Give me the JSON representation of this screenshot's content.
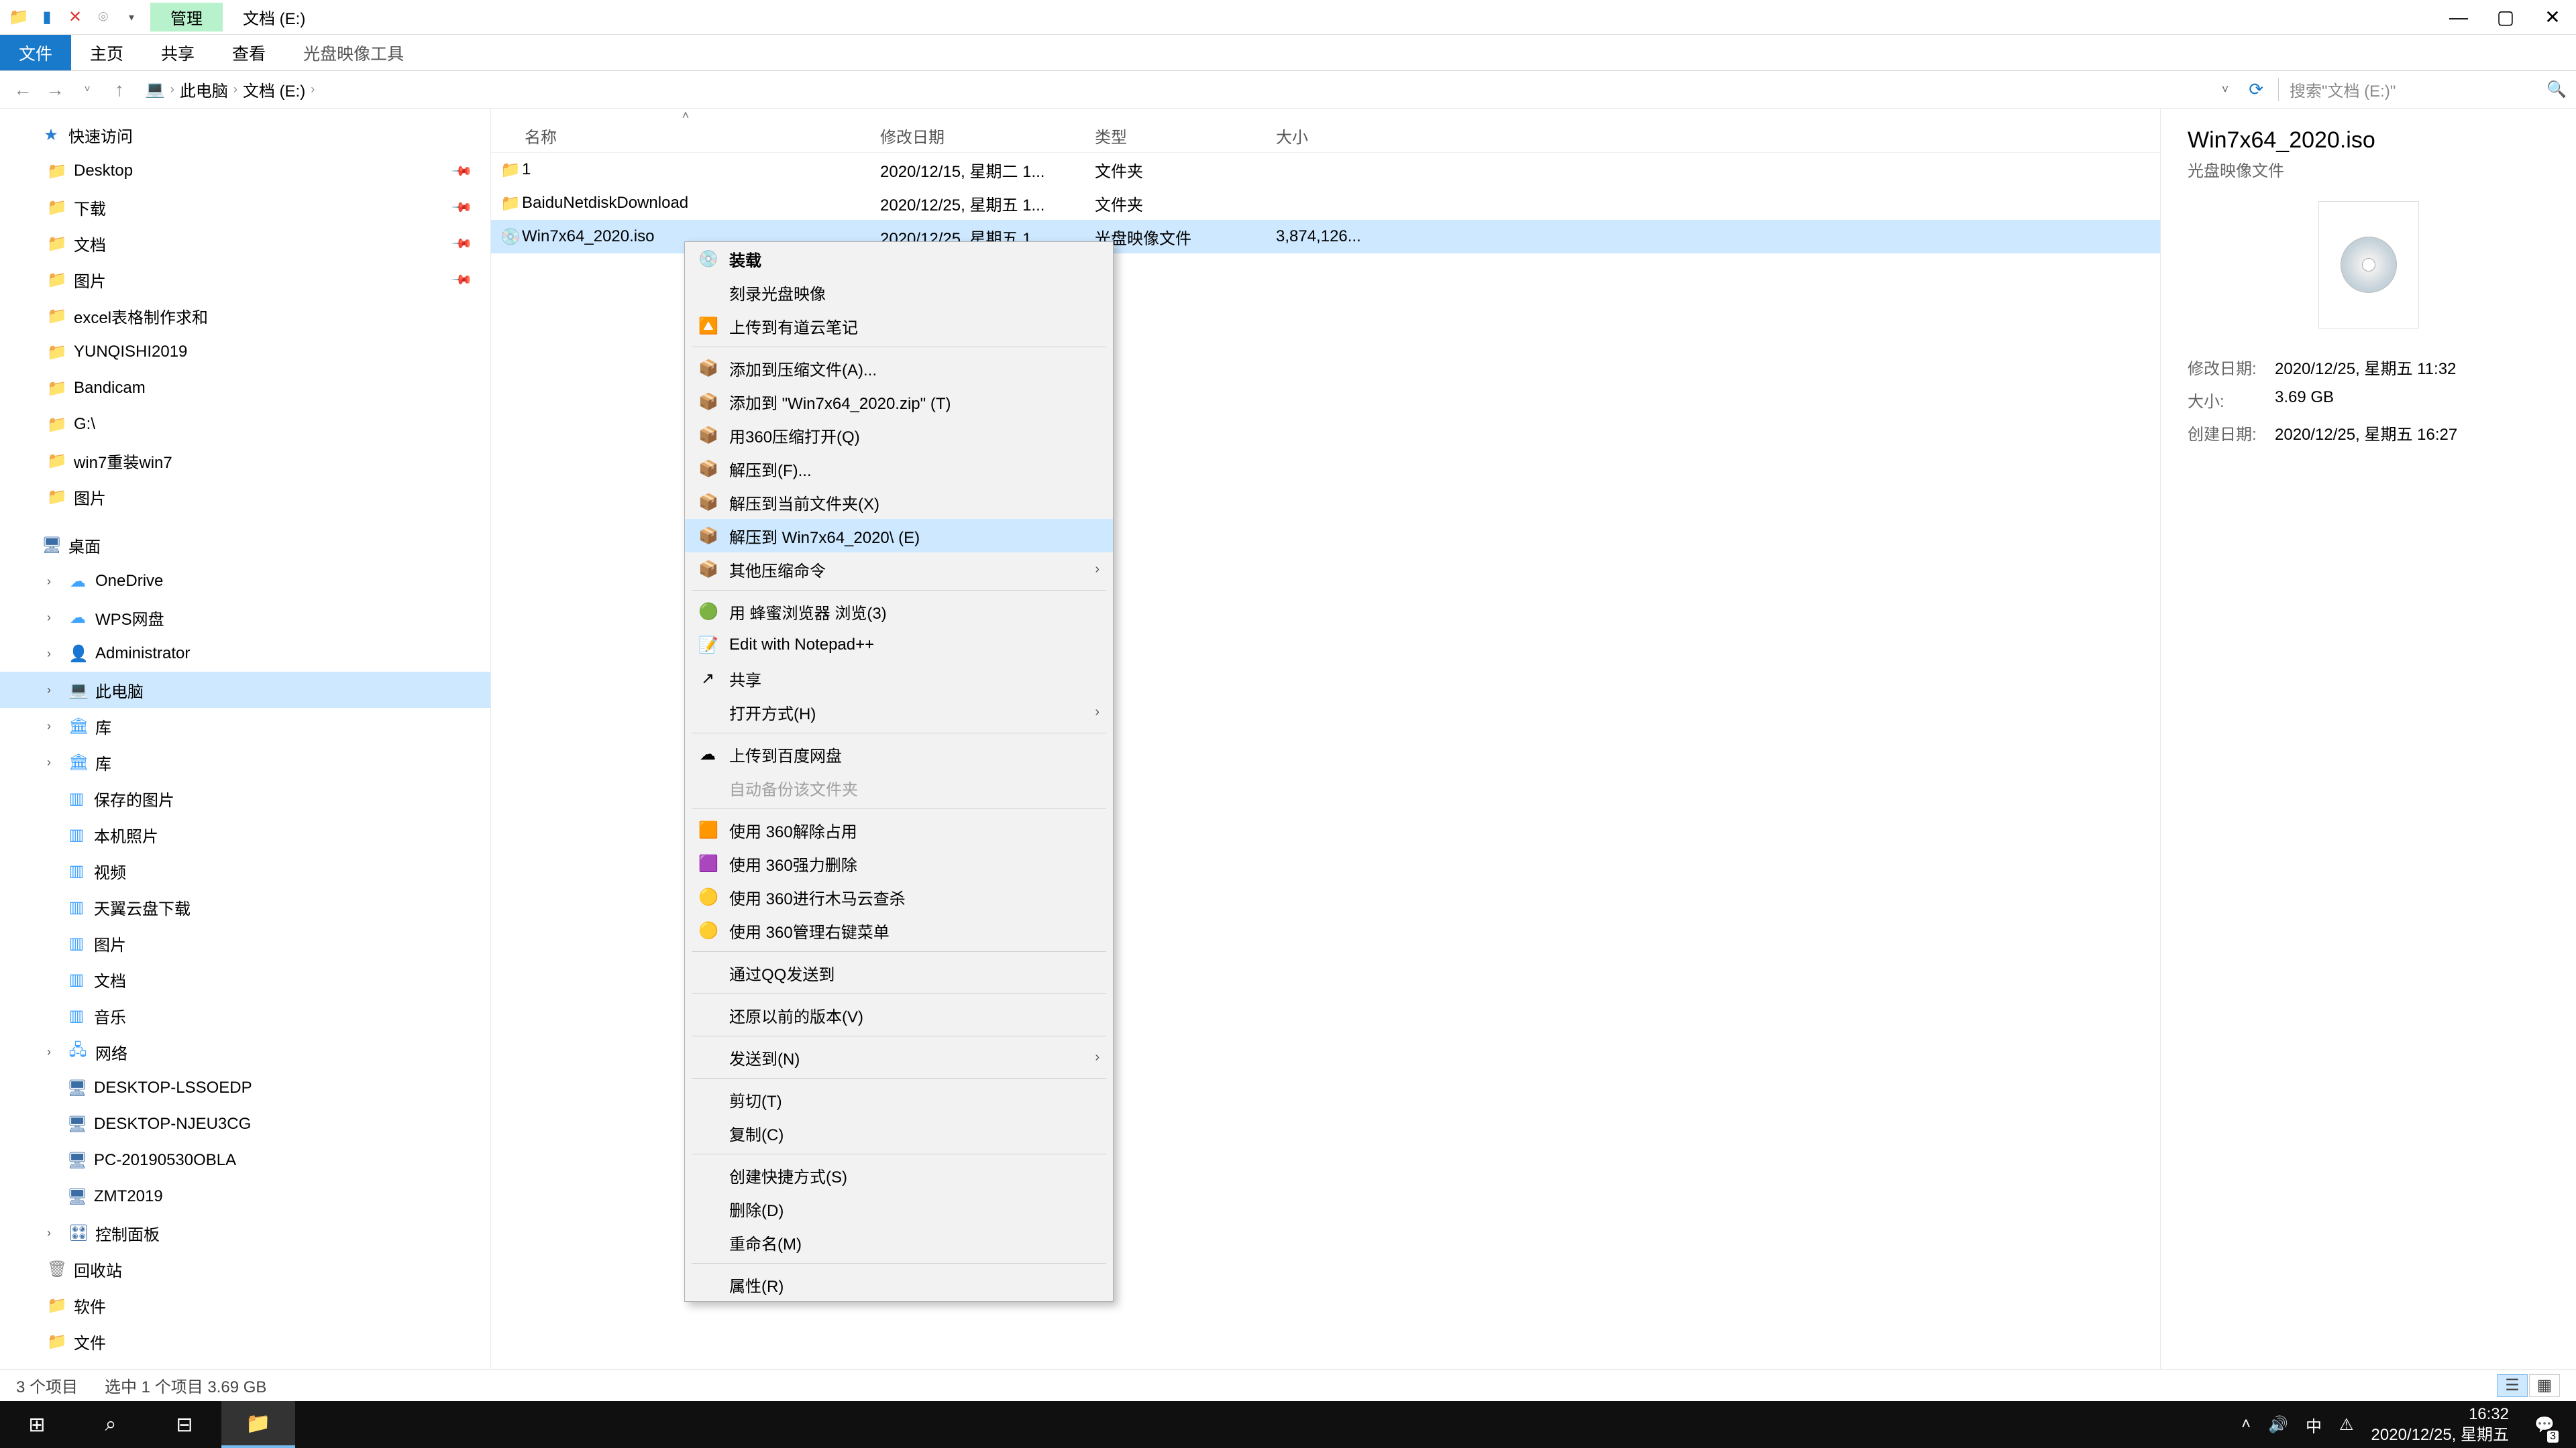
{
  "titlebar": {
    "context_tab": "管理",
    "title": "文档 (E:)"
  },
  "ribbon": {
    "file": "文件",
    "home": "主页",
    "share": "共享",
    "view": "查看",
    "disc_tools": "光盘映像工具"
  },
  "breadcrumb": {
    "root": "此电脑",
    "loc": "文档 (E:)"
  },
  "search": {
    "placeholder": "搜索\"文档 (E:)\""
  },
  "tree": {
    "quick": "快速访问",
    "items1": [
      "Desktop",
      "下载",
      "文档",
      "图片",
      "excel表格制作求和",
      "YUNQISHI2019",
      "Bandicam",
      "G:\\",
      "win7重装win7",
      "图片"
    ],
    "desktop": "桌面",
    "items2": [
      "OneDrive",
      "WPS网盘",
      "Administrator",
      "此电脑",
      "库"
    ],
    "lib": [
      "保存的图片",
      "本机照片",
      "视频",
      "天翼云盘下载",
      "图片",
      "文档",
      "音乐"
    ],
    "network": "网络",
    "net": [
      "DESKTOP-LSSOEDP",
      "DESKTOP-NJEU3CG",
      "PC-20190530OBLA",
      "ZMT2019"
    ],
    "cp": "控制面板",
    "rb": "回收站",
    "sw": "软件",
    "fl": "文件"
  },
  "columns": {
    "name": "名称",
    "date": "修改日期",
    "type": "类型",
    "size": "大小"
  },
  "rows": [
    {
      "name": "1",
      "date": "2020/12/15, 星期二 1...",
      "type": "文件夹",
      "size": "",
      "folder": true
    },
    {
      "name": "BaiduNetdiskDownload",
      "date": "2020/12/25, 星期五 1...",
      "type": "文件夹",
      "size": "",
      "folder": true
    },
    {
      "name": "Win7x64_2020.iso",
      "date": "2020/12/25, 星期五 1...",
      "type": "光盘映像文件",
      "size": "3,874,126...",
      "folder": false,
      "selected": true
    }
  ],
  "preview": {
    "title": "Win7x64_2020.iso",
    "subtitle": "光盘映像文件",
    "k1": "修改日期:",
    "v1": "2020/12/25, 星期五 11:32",
    "k2": "大小:",
    "v2": "3.69 GB",
    "k3": "创建日期:",
    "v3": "2020/12/25, 星期五 16:27"
  },
  "ctx": [
    {
      "label": "装载",
      "icon": "💿",
      "bold": true
    },
    {
      "label": "刻录光盘映像"
    },
    {
      "label": "上传到有道云笔记",
      "icon": "🔼"
    },
    {
      "sep": true
    },
    {
      "label": "添加到压缩文件(A)...",
      "icon": "📦"
    },
    {
      "label": "添加到 \"Win7x64_2020.zip\" (T)",
      "icon": "📦"
    },
    {
      "label": "用360压缩打开(Q)",
      "icon": "📦"
    },
    {
      "label": "解压到(F)...",
      "icon": "📦"
    },
    {
      "label": "解压到当前文件夹(X)",
      "icon": "📦"
    },
    {
      "label": "解压到 Win7x64_2020\\ (E)",
      "icon": "📦",
      "hover": true
    },
    {
      "label": "其他压缩命令",
      "icon": "📦",
      "submenu": true
    },
    {
      "sep": true
    },
    {
      "label": "用 蜂蜜浏览器 浏览(3)",
      "icon": "🟢"
    },
    {
      "label": "Edit with Notepad++",
      "icon": "📝"
    },
    {
      "label": "共享",
      "icon": "↗"
    },
    {
      "label": "打开方式(H)",
      "submenu": true
    },
    {
      "sep": true
    },
    {
      "label": "上传到百度网盘",
      "icon": "☁"
    },
    {
      "label": "自动备份该文件夹",
      "disabled": true
    },
    {
      "sep": true
    },
    {
      "label": "使用 360解除占用",
      "icon": "🟧"
    },
    {
      "label": "使用 360强力删除",
      "icon": "🟪"
    },
    {
      "label": "使用 360进行木马云查杀",
      "icon": "🟡"
    },
    {
      "label": "使用 360管理右键菜单",
      "icon": "🟡"
    },
    {
      "sep": true
    },
    {
      "label": "通过QQ发送到"
    },
    {
      "sep": true
    },
    {
      "label": "还原以前的版本(V)"
    },
    {
      "sep": true
    },
    {
      "label": "发送到(N)",
      "submenu": true
    },
    {
      "sep": true
    },
    {
      "label": "剪切(T)"
    },
    {
      "label": "复制(C)"
    },
    {
      "sep": true
    },
    {
      "label": "创建快捷方式(S)"
    },
    {
      "label": "删除(D)"
    },
    {
      "label": "重命名(M)"
    },
    {
      "sep": true
    },
    {
      "label": "属性(R)"
    }
  ],
  "status": {
    "count": "3 个项目",
    "sel": "选中 1 个项目  3.69 GB"
  },
  "taskbar": {
    "ime": "中",
    "time": "16:32",
    "date": "2020/12/25, 星期五",
    "badge": "3"
  }
}
